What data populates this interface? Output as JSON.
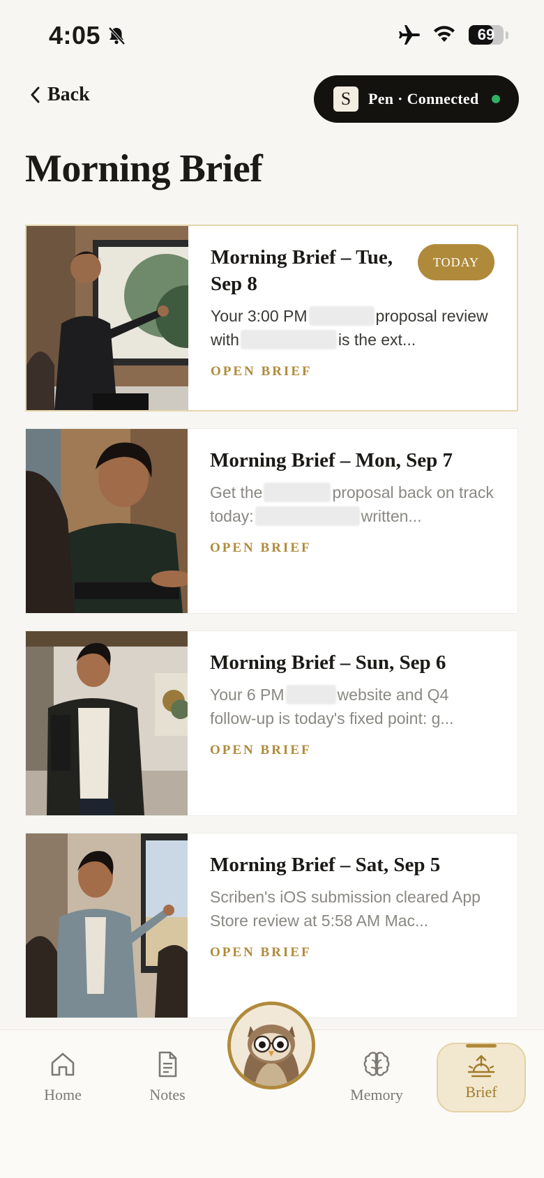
{
  "status_bar": {
    "time": "4:05",
    "battery": "69",
    "battery_level": 0.69
  },
  "header": {
    "back_label": "Back",
    "pen_badge_letter": "S",
    "pen_status": "Pen · Connected",
    "title": "Morning Brief"
  },
  "briefs": [
    {
      "title": "Morning Brief – Tue, Sep 8",
      "badge": "TODAY",
      "excerpt_parts": [
        "Your 3:00 PM",
        "proposal review with",
        "is the ext..."
      ],
      "open_label": "OPEN BRIEF"
    },
    {
      "title": "Morning Brief – Mon, Sep 7",
      "excerpt_parts": [
        "Get the",
        "proposal back on track today:",
        "written..."
      ],
      "open_label": "OPEN BRIEF"
    },
    {
      "title": "Morning Brief – Sun, Sep 6",
      "excerpt_parts": [
        "Your 6 PM",
        "website and Q4 follow-up is today's fixed point: g..."
      ],
      "open_label": "OPEN BRIEF"
    },
    {
      "title": "Morning Brief – Sat, Sep 5",
      "excerpt_parts": [
        "Scriben's iOS submission cleared App Store review at 5:58 AM Mac..."
      ],
      "open_label": "OPEN BRIEF"
    }
  ],
  "tabs": {
    "home": "Home",
    "notes": "Notes",
    "memory": "Memory",
    "brief": "Brief"
  },
  "colors": {
    "accent": "#b08a3b",
    "background": "#f7f6f2",
    "connected": "#2fb062"
  }
}
